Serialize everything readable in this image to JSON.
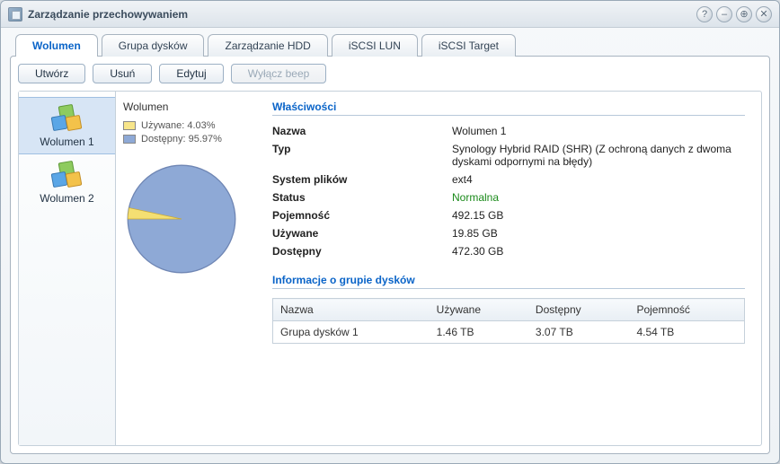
{
  "window": {
    "title": "Zarządzanie przechowywaniem"
  },
  "tabs": {
    "volume": "Wolumen",
    "diskgroup": "Grupa dysków",
    "hdd": "Zarządzanie HDD",
    "lun": "iSCSI LUN",
    "target": "iSCSI Target"
  },
  "toolbar": {
    "create": "Utwórz",
    "remove": "Usuń",
    "edit": "Edytuj",
    "beep_off": "Wyłącz beep"
  },
  "sidebar": {
    "item1": "Wolumen 1",
    "item2": "Wolumen 2"
  },
  "mini": {
    "title": "Wolumen",
    "used_label": "Używane: 4.03%",
    "avail_label": "Dostępny: 95.97%"
  },
  "chart_data": {
    "type": "pie",
    "title": "Wolumen",
    "series": [
      {
        "name": "Używane",
        "value_pct": 4.03,
        "color": "#f4df72"
      },
      {
        "name": "Dostępny",
        "value_pct": 95.97,
        "color": "#8ea9d6"
      }
    ]
  },
  "properties": {
    "section_title": "Właściwości",
    "name_k": "Nazwa",
    "name_v": "Wolumen 1",
    "type_k": "Typ",
    "type_v": "Synology Hybrid RAID (SHR) (Z ochroną danych z dwoma dyskami odpornymi na błędy)",
    "fs_k": "System plików",
    "fs_v": "ext4",
    "status_k": "Status",
    "status_v": "Normalna",
    "cap_k": "Pojemność",
    "cap_v": "492.15 GB",
    "used_k": "Używane",
    "used_v": "19.85 GB",
    "avail_k": "Dostępny",
    "avail_v": "472.30 GB"
  },
  "dg": {
    "section_title": "Informacje o grupie dysków",
    "h_name": "Nazwa",
    "h_used": "Używane",
    "h_avail": "Dostępny",
    "h_cap": "Pojemność",
    "r1_name": "Grupa dysków 1",
    "r1_used": "1.46 TB",
    "r1_avail": "3.07 TB",
    "r1_cap": "4.54 TB"
  }
}
